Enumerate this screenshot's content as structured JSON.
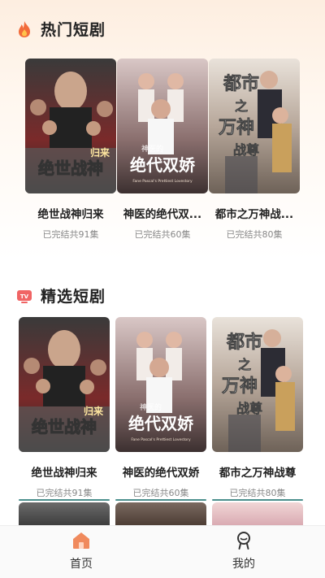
{
  "sections": [
    {
      "title": "热门短剧",
      "icon": "fire-icon",
      "items": [
        {
          "title": "绝世战神归来",
          "meta": "已完结共91集"
        },
        {
          "title": "神医的绝代双...",
          "meta": "已完结共60集"
        },
        {
          "title": "都市之万神战...",
          "meta": "已完结共80集"
        }
      ]
    },
    {
      "title": "精选短剧",
      "icon": "tv-icon",
      "items": [
        {
          "title": "绝世战神归来",
          "meta": "已完结共91集"
        },
        {
          "title": "神医的绝代双娇",
          "meta": "已完结共60集"
        },
        {
          "title": "都市之万神战尊",
          "meta": "已完结共80集"
        }
      ]
    }
  ],
  "posters": {
    "p1": {
      "main": "绝世战神",
      "sub": "归来"
    },
    "p2": {
      "small": "神医的",
      "main": "绝代双娇",
      "sub": "Fane Pascal's Prettiest Lovestory"
    },
    "p3": {
      "main1": "都市",
      "main2": "之",
      "main3": "万神",
      "main4": "战尊"
    }
  },
  "tabbar": {
    "home": {
      "label": "首页",
      "icon": "home-icon"
    },
    "mine": {
      "label": "我的",
      "icon": "profile-icon"
    }
  },
  "colors": {
    "accent": "#f08a5d",
    "teal": "#4b8f8c"
  }
}
